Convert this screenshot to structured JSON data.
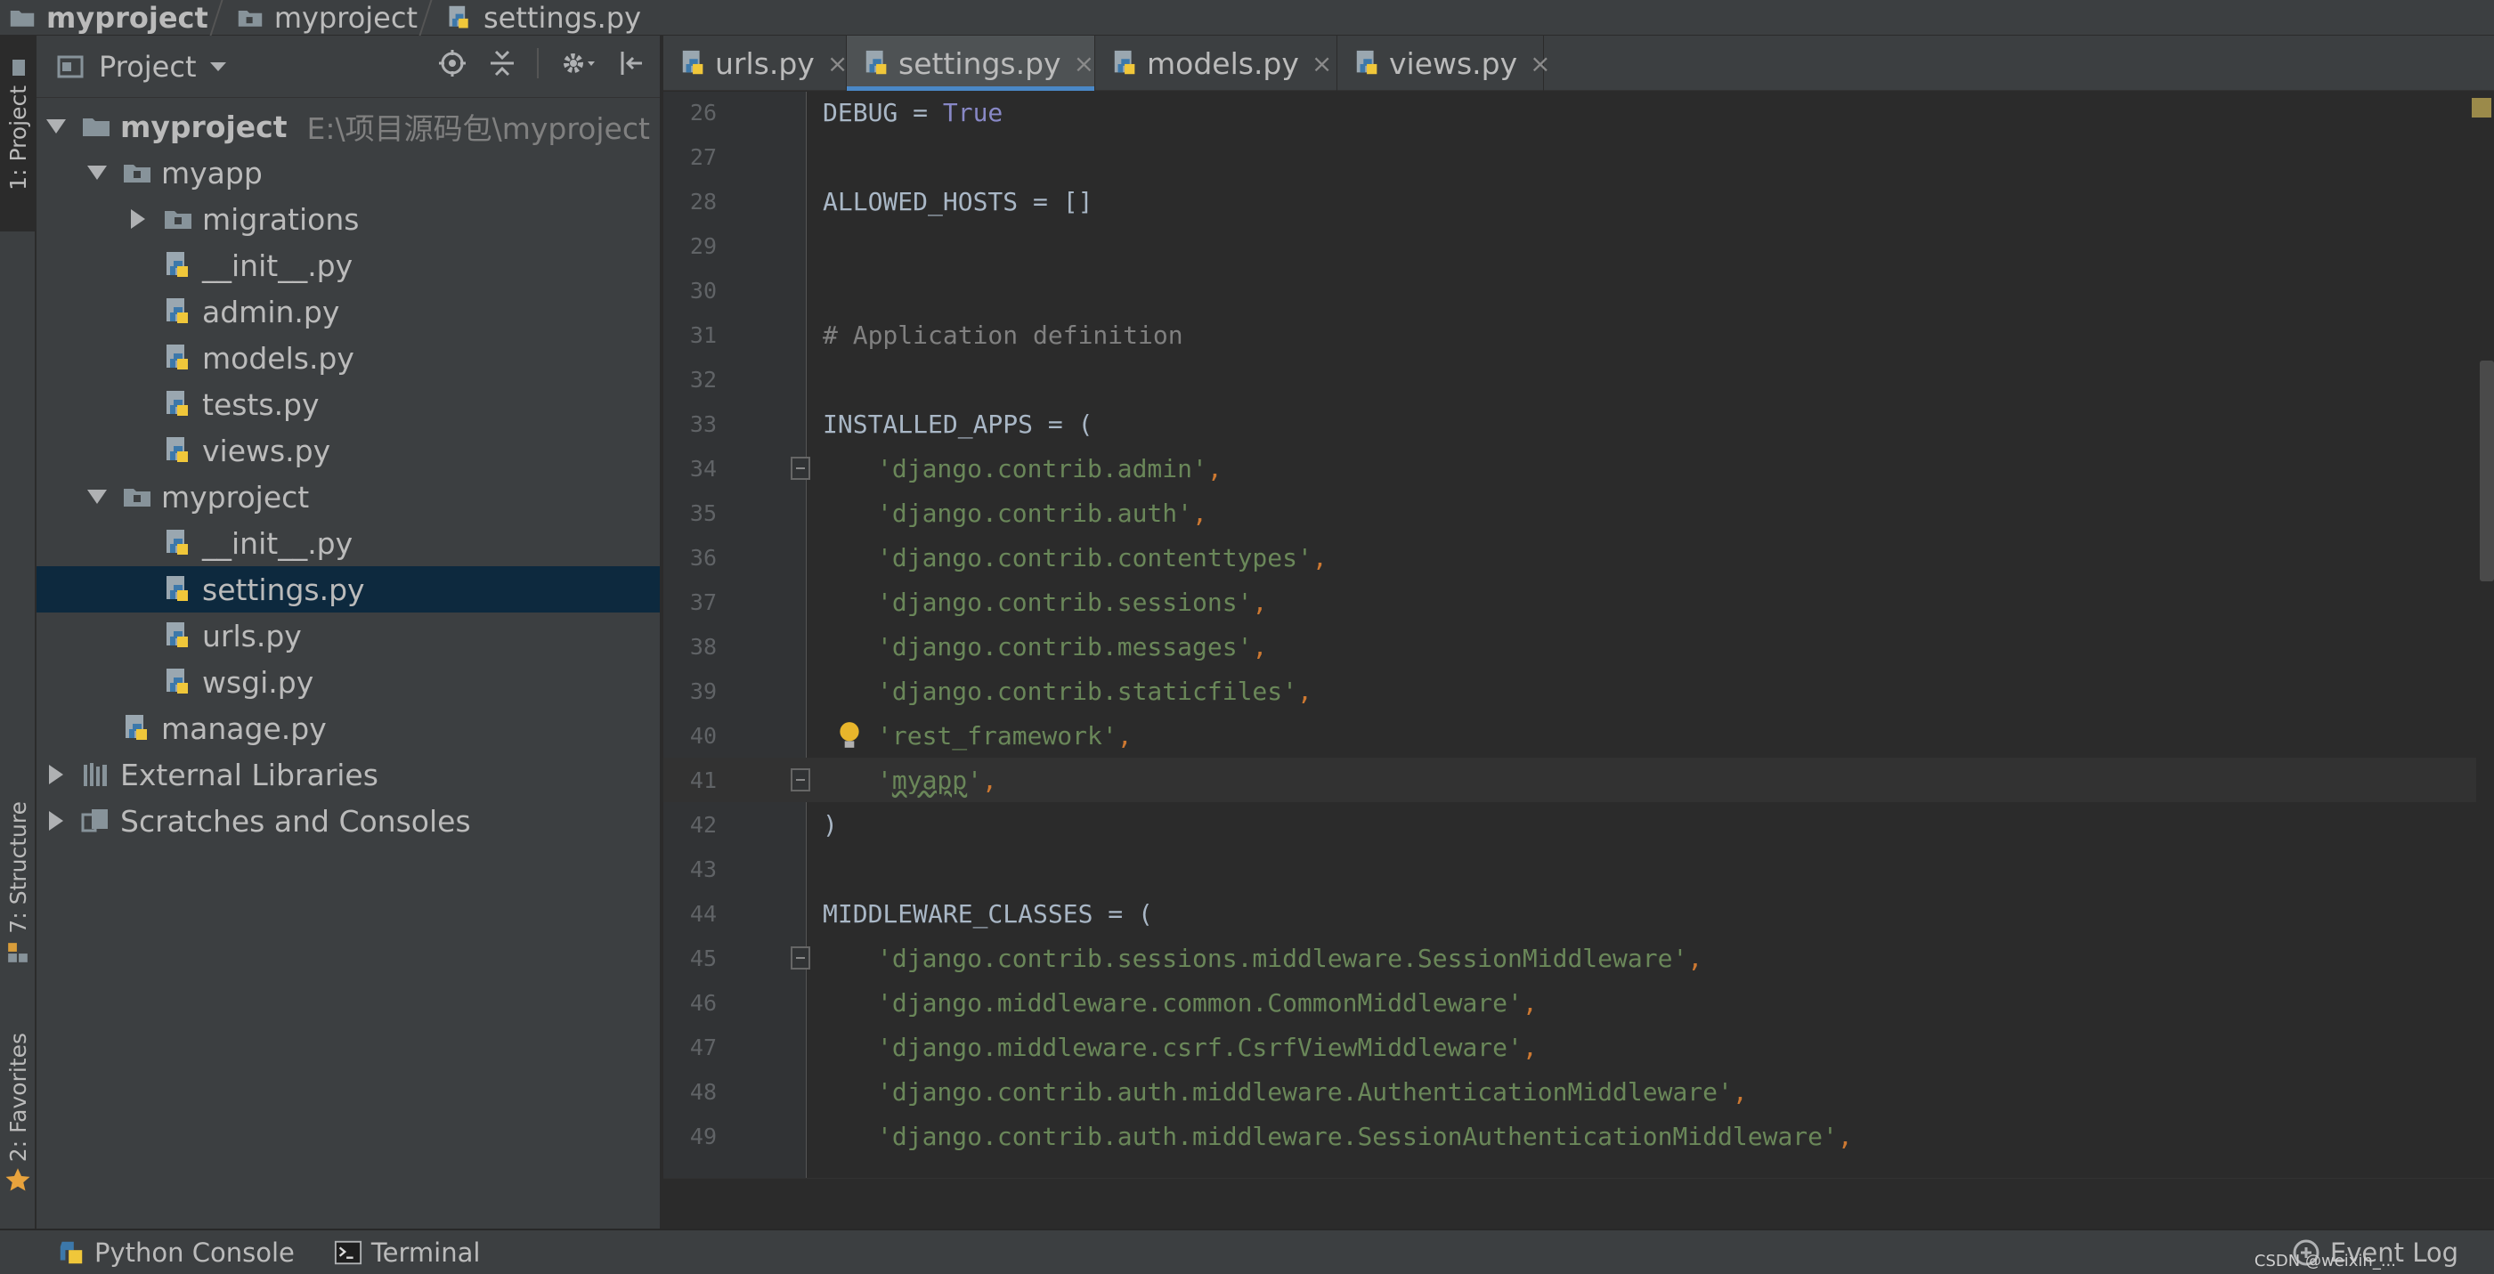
{
  "breadcrumb": [
    {
      "label": "myproject",
      "bold": true
    },
    {
      "label": "myproject",
      "bold": false
    },
    {
      "label": "settings.py",
      "bold": false
    }
  ],
  "left_strip": {
    "project_tab": "1: Project",
    "structure_tab": "7: Structure",
    "favorites_tab": "2: Favorites"
  },
  "project_panel": {
    "title": "Project",
    "tree": [
      {
        "label": "myproject",
        "path": "E:\\项目源码包\\myproject",
        "bold": true
      },
      {
        "label": "myapp"
      },
      {
        "label": "migrations"
      },
      {
        "label": "__init__.py"
      },
      {
        "label": "admin.py"
      },
      {
        "label": "models.py"
      },
      {
        "label": "tests.py"
      },
      {
        "label": "views.py"
      },
      {
        "label": "myproject"
      },
      {
        "label": "__init__.py"
      },
      {
        "label": "settings.py",
        "selected": true
      },
      {
        "label": "urls.py"
      },
      {
        "label": "wsgi.py"
      },
      {
        "label": "manage.py"
      },
      {
        "label": "External Libraries"
      },
      {
        "label": "Scratches and Consoles"
      }
    ]
  },
  "tabs": [
    {
      "label": "urls.py"
    },
    {
      "label": "settings.py",
      "active": true
    },
    {
      "label": "models.py"
    },
    {
      "label": "views.py"
    }
  ],
  "tab_close_glyph": "×",
  "editor": {
    "line_numbers": [
      "26",
      "27",
      "28",
      "29",
      "30",
      "31",
      "32",
      "33",
      "34",
      "35",
      "36",
      "37",
      "38",
      "39",
      "40",
      "41",
      "42",
      "43",
      "44",
      "45",
      "46",
      "47",
      "48",
      "49"
    ],
    "code": {
      "l26a": "DEBUG = ",
      "l26b": "True",
      "l28": "ALLOWED_HOSTS = []",
      "l31": "# Application definition",
      "l33": "INSTALLED_APPS = (",
      "l34": "'django.contrib.admin'",
      "l35": "'django.contrib.auth'",
      "l36": "'django.contrib.contenttypes'",
      "l37": "'django.contrib.sessions'",
      "l38": "'django.contrib.messages'",
      "l39": "'django.contrib.staticfiles'",
      "l40": "'rest_framework'",
      "l41q1": "'",
      "l41w": "myapp",
      "l41q2": "'",
      "l42": ")",
      "l44": "MIDDLEWARE_CLASSES = (",
      "l45": "'django.contrib.sessions.middleware.SessionMiddleware'",
      "l46": "'django.middleware.common.CommonMiddleware'",
      "l47": "'django.middleware.csrf.CsrfViewMiddleware'",
      "l48": "'django.contrib.auth.middleware.AuthenticationMiddleware'",
      "l49": "'django.contrib.auth.middleware.SessionAuthenticationMiddleware'",
      "comma": ","
    }
  },
  "bottom_bar": {
    "python_console": "Python Console",
    "terminal": "Terminal",
    "event_log": "Event Log",
    "watermark": "CSDN @weixin_..."
  },
  "colors": {
    "background": "#2b2b2b",
    "panel": "#3c3f41",
    "selection": "#0d293e",
    "keyword": "#8888c6",
    "string": "#6a8759",
    "comment": "#808080",
    "accent": "#4a88c7"
  }
}
